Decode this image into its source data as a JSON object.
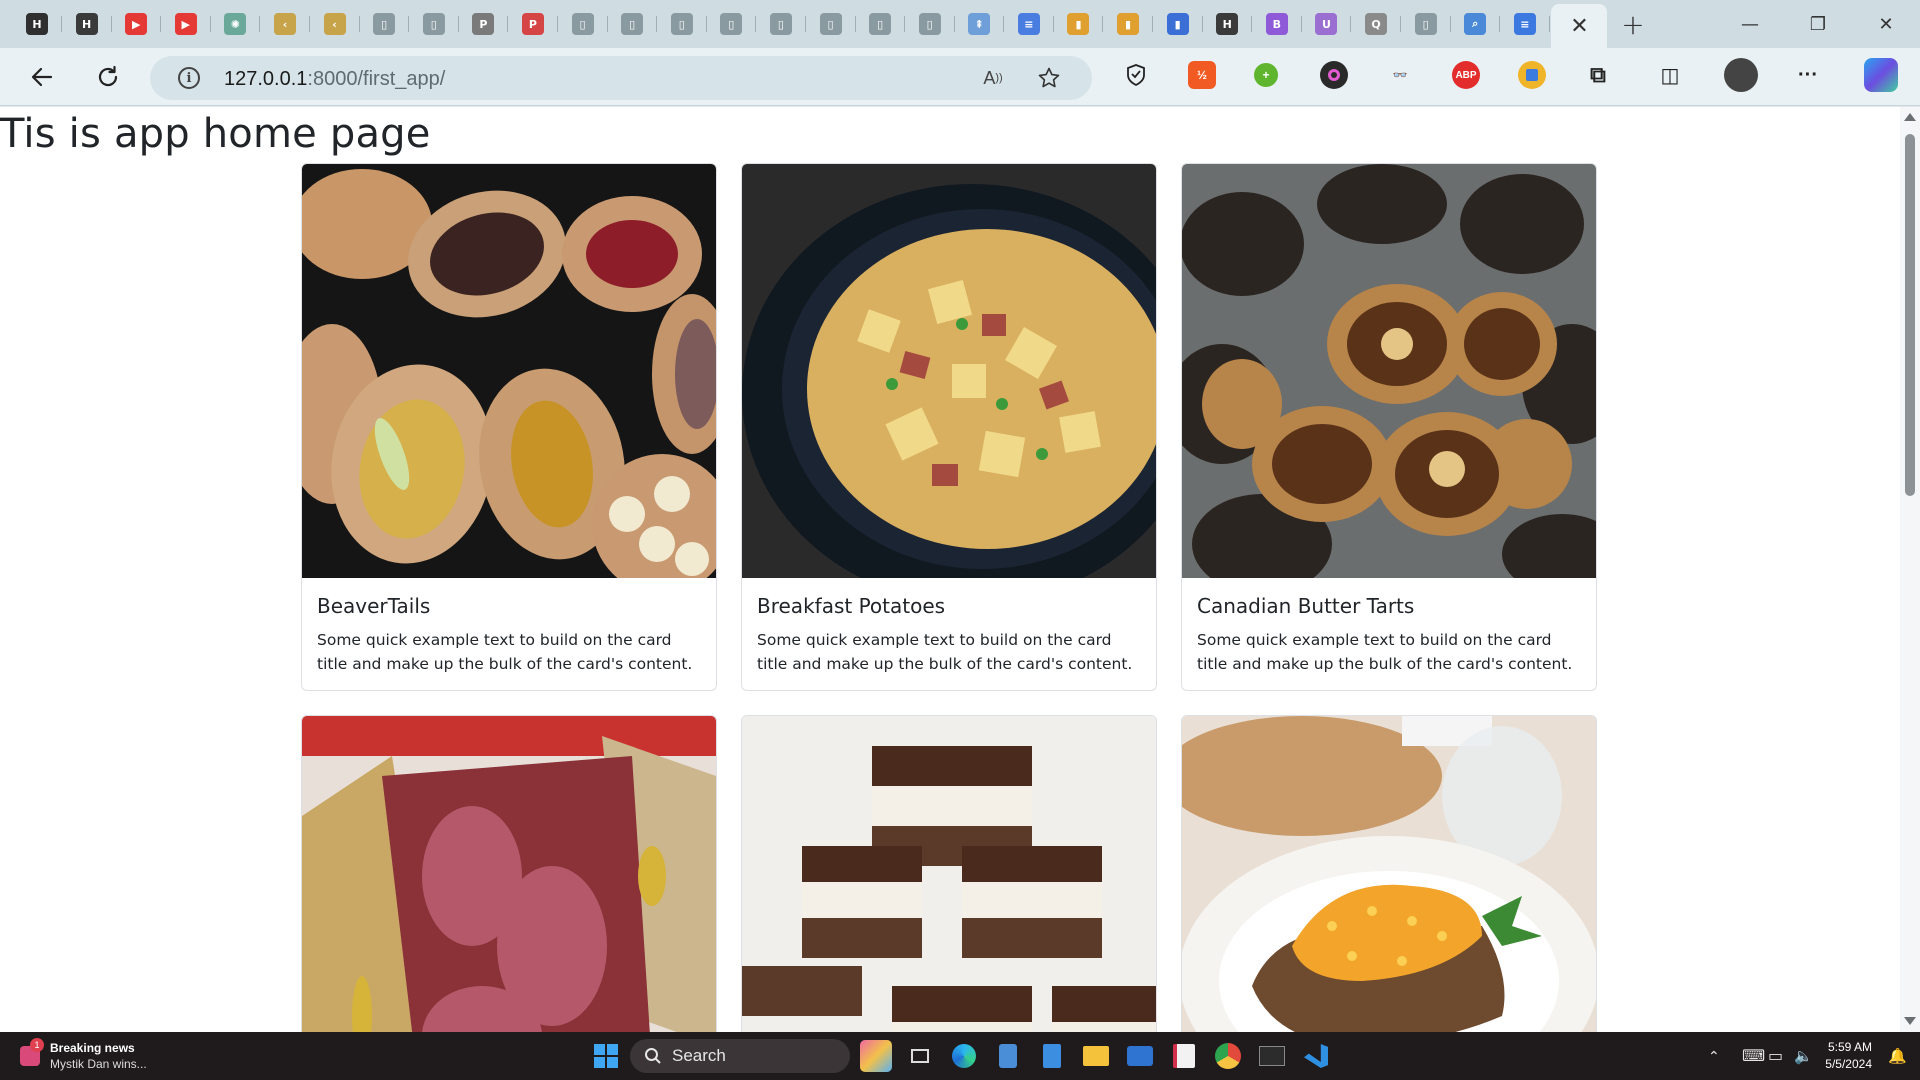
{
  "browser": {
    "tabs": [
      {
        "icon": "hackerrank-icon",
        "color": "#2f2f2f",
        "glyph": "H"
      },
      {
        "icon": "hackerrank-icon",
        "color": "#3a3a3a",
        "glyph": "H"
      },
      {
        "icon": "youtube-icon",
        "color": "#e53935",
        "glyph": "▶"
      },
      {
        "icon": "youtube-icon",
        "color": "#e53935",
        "glyph": "▶"
      },
      {
        "icon": "chatgpt-icon",
        "color": "#6aa99a",
        "glyph": "✺"
      },
      {
        "icon": "arrow-left-tab-icon",
        "color": "#c7a34a",
        "glyph": "‹"
      },
      {
        "icon": "arrow-left-tab-icon",
        "color": "#c7a34a",
        "glyph": "‹"
      },
      {
        "icon": "page-icon",
        "color": "#8a9aa1",
        "glyph": "▯"
      },
      {
        "icon": "page-icon",
        "color": "#8a9aa1",
        "glyph": "▯"
      },
      {
        "icon": "pdf-icon",
        "color": "#7a7a7a",
        "glyph": "P"
      },
      {
        "icon": "pdf-icon",
        "color": "#d64545",
        "glyph": "P"
      },
      {
        "icon": "page-icon",
        "color": "#8a9aa1",
        "glyph": "▯"
      },
      {
        "icon": "page-icon",
        "color": "#8a9aa1",
        "glyph": "▯"
      },
      {
        "icon": "page-icon",
        "color": "#8a9aa1",
        "glyph": "▯"
      },
      {
        "icon": "page-icon",
        "color": "#8a9aa1",
        "glyph": "▯"
      },
      {
        "icon": "page-icon",
        "color": "#8a9aa1",
        "glyph": "▯"
      },
      {
        "icon": "page-icon",
        "color": "#8a9aa1",
        "glyph": "▯"
      },
      {
        "icon": "page-icon",
        "color": "#8a9aa1",
        "glyph": "▯"
      },
      {
        "icon": "page-icon",
        "color": "#8a9aa1",
        "glyph": "▯"
      },
      {
        "icon": "pin-icon",
        "color": "#6f9fd8",
        "glyph": "⇞"
      },
      {
        "icon": "docs-icon",
        "color": "#4a7de0",
        "glyph": "≡"
      },
      {
        "icon": "chart-icon",
        "color": "#e0a030",
        "glyph": "▮"
      },
      {
        "icon": "chart-icon",
        "color": "#e0a030",
        "glyph": "▮"
      },
      {
        "icon": "chart-icon",
        "color": "#3b6fd6",
        "glyph": "▮"
      },
      {
        "icon": "hope-icon",
        "color": "#3a3a3a",
        "glyph": "H"
      },
      {
        "icon": "bold-b-icon",
        "color": "#8e5ad8",
        "glyph": "B"
      },
      {
        "icon": "u-icon",
        "color": "#9b6fd2",
        "glyph": "U"
      },
      {
        "icon": "q-icon",
        "color": "#8a8a8a",
        "glyph": "Q"
      },
      {
        "icon": "page-icon",
        "color": "#8a9aa1",
        "glyph": "▯"
      },
      {
        "icon": "magnifier-tab-icon",
        "color": "#4a88d8",
        "glyph": "⌕"
      },
      {
        "icon": "docs-icon",
        "color": "#3b78e0",
        "glyph": "≡"
      }
    ],
    "active_tab_close": "✕",
    "new_tab": "+",
    "window_controls": {
      "minimize": "—",
      "restore": "❐",
      "close": "✕"
    },
    "address": {
      "host": "127.0.0.1",
      "rest": ":8000/first_app/"
    }
  },
  "page": {
    "heading": "Tis is app home page",
    "cards": [
      {
        "title": "BeaverTails",
        "text": "Some quick example text to build on the card title and make up the bulk of the card's content."
      },
      {
        "title": "Breakfast Potatoes",
        "text": "Some quick example text to build on the card title and make up the bulk of the card's content."
      },
      {
        "title": "Canadian Butter Tarts",
        "text": "Some quick example text to build on the card title and make up the bulk of the card's content."
      },
      {
        "title": "",
        "text": ""
      },
      {
        "title": "",
        "text": ""
      },
      {
        "title": "",
        "text": ""
      }
    ]
  },
  "taskbar": {
    "news_title": "Breaking news",
    "news_sub": "Mystik Dan wins...",
    "news_badge": "1",
    "search_label": "Search",
    "time": "5:59 AM",
    "date": "5/5/2024"
  }
}
